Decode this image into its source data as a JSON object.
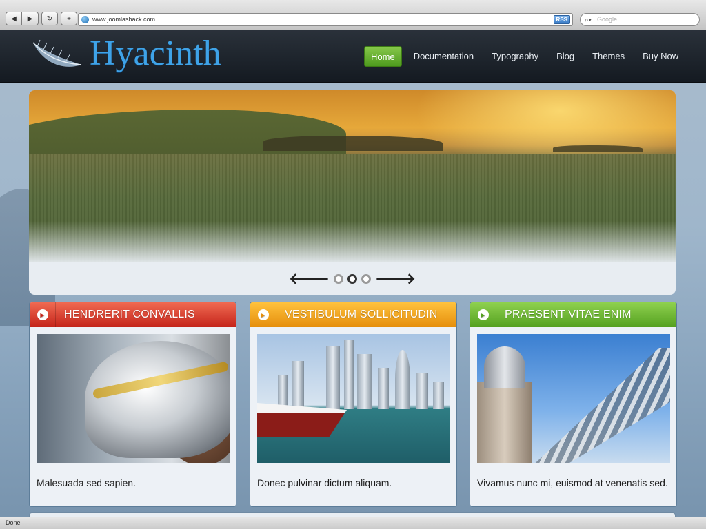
{
  "browser": {
    "url": "www.joomlashack.com",
    "rss_label": "RSS",
    "search_placeholder": "Google",
    "status": "Done"
  },
  "site": {
    "logo": "Hyacinth",
    "menu": [
      {
        "label": "Home",
        "active": true
      },
      {
        "label": "Documentation"
      },
      {
        "label": "Typography"
      },
      {
        "label": "Blog"
      },
      {
        "label": "Themes"
      },
      {
        "label": "Buy Now"
      }
    ],
    "slider": {
      "slides": 3,
      "active_slide": 2
    }
  },
  "boxes": [
    {
      "title": "HENDRERIT CONVALLIS",
      "text": "Malesuada sed sapien.",
      "color": "#d63a25"
    },
    {
      "title": "VESTIBULUM SOLLICITUDIN",
      "text": "Donec pulvinar dictum aliquam.",
      "color": "#f3a51c"
    },
    {
      "title": "PRAESENT VITAE ENIM",
      "text": "Vivamus nunc mi, euismod at venenatis sed.",
      "color": "#6db735"
    }
  ],
  "colors": {
    "header_bg": "#1c2229",
    "logo": "#3fa3e8",
    "active_menu": "#5ea82a"
  }
}
